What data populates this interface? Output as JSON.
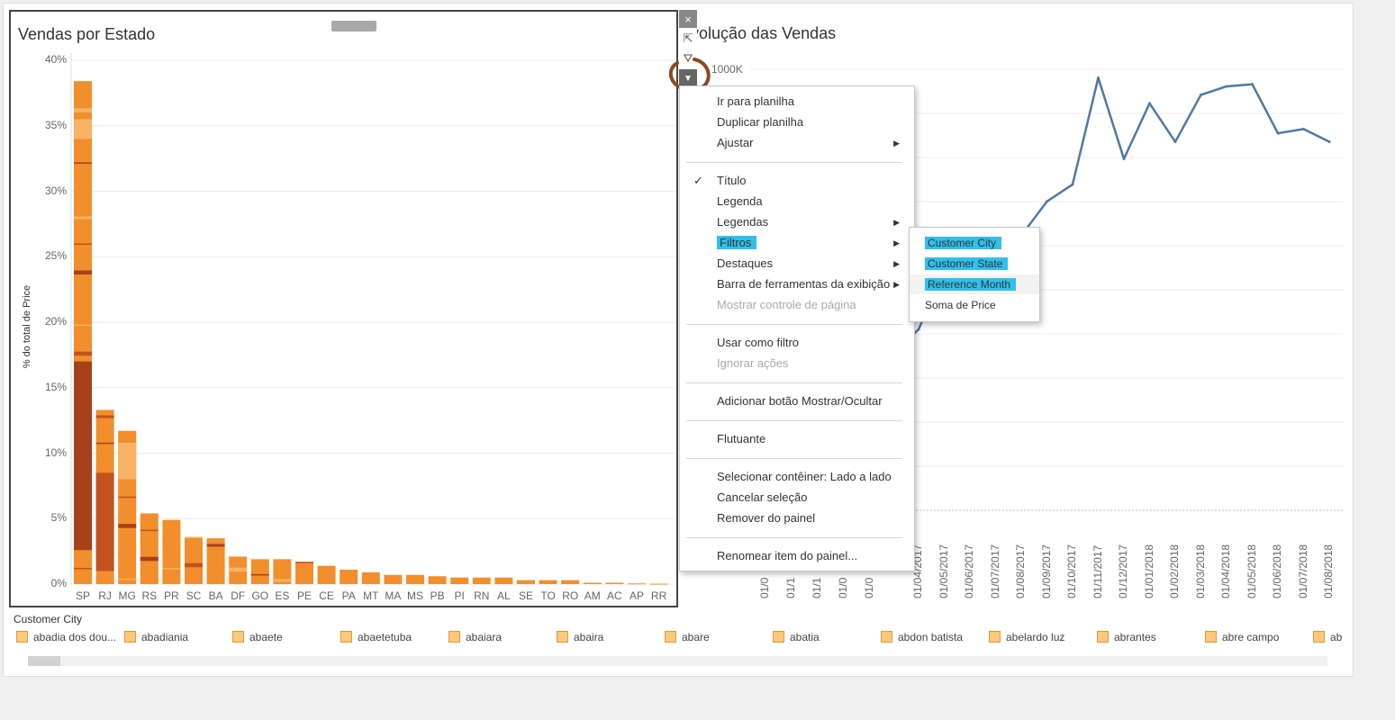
{
  "left_chart": {
    "title": "Vendas por Estado",
    "ylabel": "% do total de Price",
    "yticks": [
      "40%",
      "35%",
      "30%",
      "25%",
      "20%",
      "15%",
      "10%",
      "5%",
      "0%"
    ],
    "states": [
      "SP",
      "RJ",
      "MG",
      "RS",
      "PR",
      "SC",
      "BA",
      "DF",
      "GO",
      "ES",
      "PE",
      "CE",
      "PA",
      "MT",
      "MA",
      "MS",
      "PB",
      "PI",
      "RN",
      "AL",
      "SE",
      "TO",
      "RO",
      "AM",
      "AC",
      "AP",
      "RR"
    ],
    "colors": {
      "light": "#f8b366",
      "mid": "#f28e2b",
      "dark": "#c2531e",
      "darker": "#a8401a"
    }
  },
  "chart_data": [
    {
      "type": "bar",
      "title": "Vendas por Estado",
      "xlabel": "",
      "ylabel": "% do total de Price",
      "categories": [
        "SP",
        "RJ",
        "MG",
        "RS",
        "PR",
        "SC",
        "BA",
        "DF",
        "GO",
        "ES",
        "PE",
        "CE",
        "PA",
        "MT",
        "MA",
        "MS",
        "PB",
        "PI",
        "RN",
        "AL",
        "SE",
        "TO",
        "RO",
        "AM",
        "AC",
        "AP",
        "RR"
      ],
      "values": [
        38.4,
        13.3,
        11.7,
        5.4,
        4.9,
        3.6,
        3.5,
        2.1,
        1.9,
        1.9,
        1.7,
        1.4,
        1.1,
        0.9,
        0.7,
        0.7,
        0.6,
        0.5,
        0.5,
        0.5,
        0.3,
        0.3,
        0.3,
        0.1,
        0.1,
        0.05,
        0.03
      ],
      "ylim": [
        0,
        40
      ],
      "grid": true
    },
    {
      "type": "line",
      "title": "Evolução das Vendas",
      "x": [
        "01/04/2017",
        "01/05/2017",
        "01/06/2017",
        "01/07/2017",
        "01/08/2017",
        "01/09/2017",
        "01/10/2017",
        "01/11/2017",
        "01/12/2017",
        "01/01/2018",
        "01/02/2018",
        "01/03/2018",
        "01/04/2018",
        "01/05/2018",
        "01/06/2018",
        "01/07/2018",
        "01/08/2018"
      ],
      "series": [
        {
          "values": [
            420,
            560,
            530,
            590,
            640,
            720,
            760,
            1010,
            820,
            950,
            860,
            970,
            990,
            995,
            880,
            890,
            860
          ]
        }
      ],
      "ylim": [
        0,
        1030
      ],
      "grid": true
    }
  ],
  "right_chart": {
    "title": "Evolução das Vendas",
    "ytick_top": "1000K",
    "clipped_dates": [
      "01/0",
      "01/1",
      "01/1",
      "01/0",
      "01/0"
    ],
    "line_color": "#4e79a7"
  },
  "toolbar": {
    "close_icon": "×",
    "popout_icon": "⇱",
    "filter_icon": "⛛",
    "more_icon": "▼"
  },
  "context_menu": {
    "items": [
      {
        "label": "Ir para planilha"
      },
      {
        "label": "Duplicar planilha"
      },
      {
        "label": "Ajustar",
        "submenu": true
      },
      {
        "label": "Título",
        "checked": "✓"
      },
      {
        "label": "Legenda"
      },
      {
        "label": "Legendas",
        "submenu": true
      },
      {
        "label": "Filtros",
        "submenu": true
      },
      {
        "label": "Destaques",
        "submenu": true
      },
      {
        "label": "Barra de ferramentas da exibição",
        "submenu": true
      },
      {
        "label": "Mostrar controle de página",
        "disabled": true
      },
      {
        "label": "Usar como filtro"
      },
      {
        "label": "Ignorar ações",
        "disabled": true
      },
      {
        "label": "Adicionar botão Mostrar/Ocultar"
      },
      {
        "label": "Flutuante"
      },
      {
        "label": "Selecionar contêiner: Lado a lado"
      },
      {
        "label": "Cancelar seleção"
      },
      {
        "label": "Remover do painel"
      },
      {
        "label": "Renomear item do painel..."
      }
    ],
    "submenu_arrow": "▶"
  },
  "filter_submenu": {
    "items": [
      "Customer City",
      "Customer State",
      "Reference Month",
      "Soma de Price"
    ]
  },
  "legend": {
    "title": "Customer City",
    "items": [
      "abadia dos dou...",
      "abadiania",
      "abaete",
      "abaetetuba",
      "abaiara",
      "abaira",
      "abare",
      "abatia",
      "abdon batista",
      "abelardo luz",
      "abrantes",
      "abre campo",
      "ab"
    ]
  },
  "annotation": {
    "color": "#8b4a1e"
  },
  "highlight_color": "#2fc0ec"
}
